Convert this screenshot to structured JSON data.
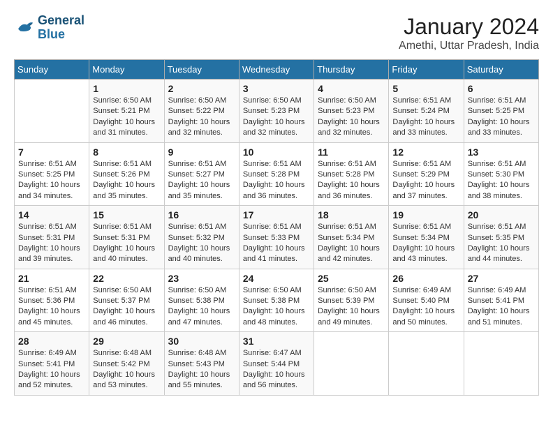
{
  "header": {
    "logo_line1": "General",
    "logo_line2": "Blue",
    "title": "January 2024",
    "subtitle": "Amethi, Uttar Pradesh, India"
  },
  "columns": [
    "Sunday",
    "Monday",
    "Tuesday",
    "Wednesday",
    "Thursday",
    "Friday",
    "Saturday"
  ],
  "weeks": [
    [
      {
        "day": "",
        "info": ""
      },
      {
        "day": "1",
        "info": "Sunrise: 6:50 AM\nSunset: 5:21 PM\nDaylight: 10 hours\nand 31 minutes."
      },
      {
        "day": "2",
        "info": "Sunrise: 6:50 AM\nSunset: 5:22 PM\nDaylight: 10 hours\nand 32 minutes."
      },
      {
        "day": "3",
        "info": "Sunrise: 6:50 AM\nSunset: 5:23 PM\nDaylight: 10 hours\nand 32 minutes."
      },
      {
        "day": "4",
        "info": "Sunrise: 6:50 AM\nSunset: 5:23 PM\nDaylight: 10 hours\nand 32 minutes."
      },
      {
        "day": "5",
        "info": "Sunrise: 6:51 AM\nSunset: 5:24 PM\nDaylight: 10 hours\nand 33 minutes."
      },
      {
        "day": "6",
        "info": "Sunrise: 6:51 AM\nSunset: 5:25 PM\nDaylight: 10 hours\nand 33 minutes."
      }
    ],
    [
      {
        "day": "7",
        "info": "Sunrise: 6:51 AM\nSunset: 5:25 PM\nDaylight: 10 hours\nand 34 minutes."
      },
      {
        "day": "8",
        "info": "Sunrise: 6:51 AM\nSunset: 5:26 PM\nDaylight: 10 hours\nand 35 minutes."
      },
      {
        "day": "9",
        "info": "Sunrise: 6:51 AM\nSunset: 5:27 PM\nDaylight: 10 hours\nand 35 minutes."
      },
      {
        "day": "10",
        "info": "Sunrise: 6:51 AM\nSunset: 5:28 PM\nDaylight: 10 hours\nand 36 minutes."
      },
      {
        "day": "11",
        "info": "Sunrise: 6:51 AM\nSunset: 5:28 PM\nDaylight: 10 hours\nand 36 minutes."
      },
      {
        "day": "12",
        "info": "Sunrise: 6:51 AM\nSunset: 5:29 PM\nDaylight: 10 hours\nand 37 minutes."
      },
      {
        "day": "13",
        "info": "Sunrise: 6:51 AM\nSunset: 5:30 PM\nDaylight: 10 hours\nand 38 minutes."
      }
    ],
    [
      {
        "day": "14",
        "info": "Sunrise: 6:51 AM\nSunset: 5:31 PM\nDaylight: 10 hours\nand 39 minutes."
      },
      {
        "day": "15",
        "info": "Sunrise: 6:51 AM\nSunset: 5:31 PM\nDaylight: 10 hours\nand 40 minutes."
      },
      {
        "day": "16",
        "info": "Sunrise: 6:51 AM\nSunset: 5:32 PM\nDaylight: 10 hours\nand 40 minutes."
      },
      {
        "day": "17",
        "info": "Sunrise: 6:51 AM\nSunset: 5:33 PM\nDaylight: 10 hours\nand 41 minutes."
      },
      {
        "day": "18",
        "info": "Sunrise: 6:51 AM\nSunset: 5:34 PM\nDaylight: 10 hours\nand 42 minutes."
      },
      {
        "day": "19",
        "info": "Sunrise: 6:51 AM\nSunset: 5:34 PM\nDaylight: 10 hours\nand 43 minutes."
      },
      {
        "day": "20",
        "info": "Sunrise: 6:51 AM\nSunset: 5:35 PM\nDaylight: 10 hours\nand 44 minutes."
      }
    ],
    [
      {
        "day": "21",
        "info": "Sunrise: 6:51 AM\nSunset: 5:36 PM\nDaylight: 10 hours\nand 45 minutes."
      },
      {
        "day": "22",
        "info": "Sunrise: 6:50 AM\nSunset: 5:37 PM\nDaylight: 10 hours\nand 46 minutes."
      },
      {
        "day": "23",
        "info": "Sunrise: 6:50 AM\nSunset: 5:38 PM\nDaylight: 10 hours\nand 47 minutes."
      },
      {
        "day": "24",
        "info": "Sunrise: 6:50 AM\nSunset: 5:38 PM\nDaylight: 10 hours\nand 48 minutes."
      },
      {
        "day": "25",
        "info": "Sunrise: 6:50 AM\nSunset: 5:39 PM\nDaylight: 10 hours\nand 49 minutes."
      },
      {
        "day": "26",
        "info": "Sunrise: 6:49 AM\nSunset: 5:40 PM\nDaylight: 10 hours\nand 50 minutes."
      },
      {
        "day": "27",
        "info": "Sunrise: 6:49 AM\nSunset: 5:41 PM\nDaylight: 10 hours\nand 51 minutes."
      }
    ],
    [
      {
        "day": "28",
        "info": "Sunrise: 6:49 AM\nSunset: 5:41 PM\nDaylight: 10 hours\nand 52 minutes."
      },
      {
        "day": "29",
        "info": "Sunrise: 6:48 AM\nSunset: 5:42 PM\nDaylight: 10 hours\nand 53 minutes."
      },
      {
        "day": "30",
        "info": "Sunrise: 6:48 AM\nSunset: 5:43 PM\nDaylight: 10 hours\nand 55 minutes."
      },
      {
        "day": "31",
        "info": "Sunrise: 6:47 AM\nSunset: 5:44 PM\nDaylight: 10 hours\nand 56 minutes."
      },
      {
        "day": "",
        "info": ""
      },
      {
        "day": "",
        "info": ""
      },
      {
        "day": "",
        "info": ""
      }
    ]
  ]
}
